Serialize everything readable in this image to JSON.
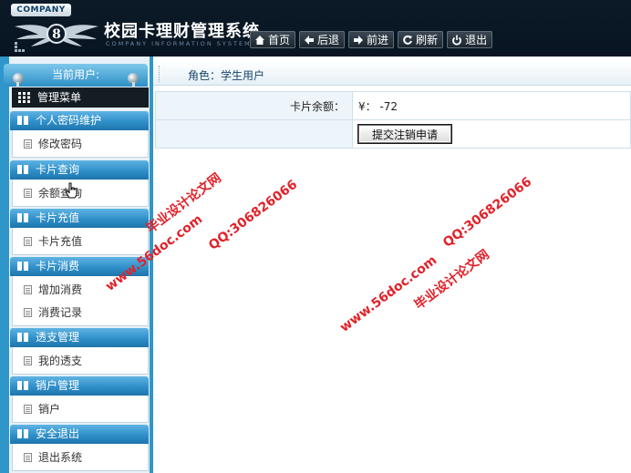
{
  "header": {
    "company_tag": "COMPANY",
    "app_title": "校园卡理财管理系统",
    "app_subtitle": "COMPANY INFORMATION SYSTEM",
    "nav": [
      {
        "label": "首页",
        "icon": "home-icon"
      },
      {
        "label": "后退",
        "icon": "arrow-left-icon"
      },
      {
        "label": "前进",
        "icon": "arrow-right-icon"
      },
      {
        "label": "刷新",
        "icon": "refresh-icon"
      },
      {
        "label": "退出",
        "icon": "power-icon"
      }
    ]
  },
  "sidebar": {
    "current_user_label": "当前用户:",
    "menu_title": "管理菜单",
    "groups": [
      {
        "title": "个人密码维护",
        "items": [
          "修改密码"
        ]
      },
      {
        "title": "卡片查询",
        "items": [
          "余额查询"
        ]
      },
      {
        "title": "卡片充值",
        "items": [
          "卡片充值"
        ]
      },
      {
        "title": "卡片消费",
        "items": [
          "增加消费",
          "消费记录"
        ]
      },
      {
        "title": "透支管理",
        "items": [
          "我的透支"
        ]
      },
      {
        "title": "销户管理",
        "items": [
          "销户"
        ]
      },
      {
        "title": "安全退出",
        "items": [
          "退出系统"
        ]
      }
    ]
  },
  "main": {
    "role_label": "角色：学生用户",
    "balance_label": "卡片余额：",
    "balance_value": "¥：  -72",
    "submit_button": "提交注销申请"
  },
  "watermarks": {
    "site_cn": "毕业设计论文网",
    "site_url": "www.56doc.com",
    "qq": "QQ:306826066"
  },
  "colors": {
    "header_bg": "#0c1a27",
    "sidebar_blue": "#2f96c9",
    "group_head": "#2f8fc8",
    "watermark_red": "#e1222a"
  }
}
